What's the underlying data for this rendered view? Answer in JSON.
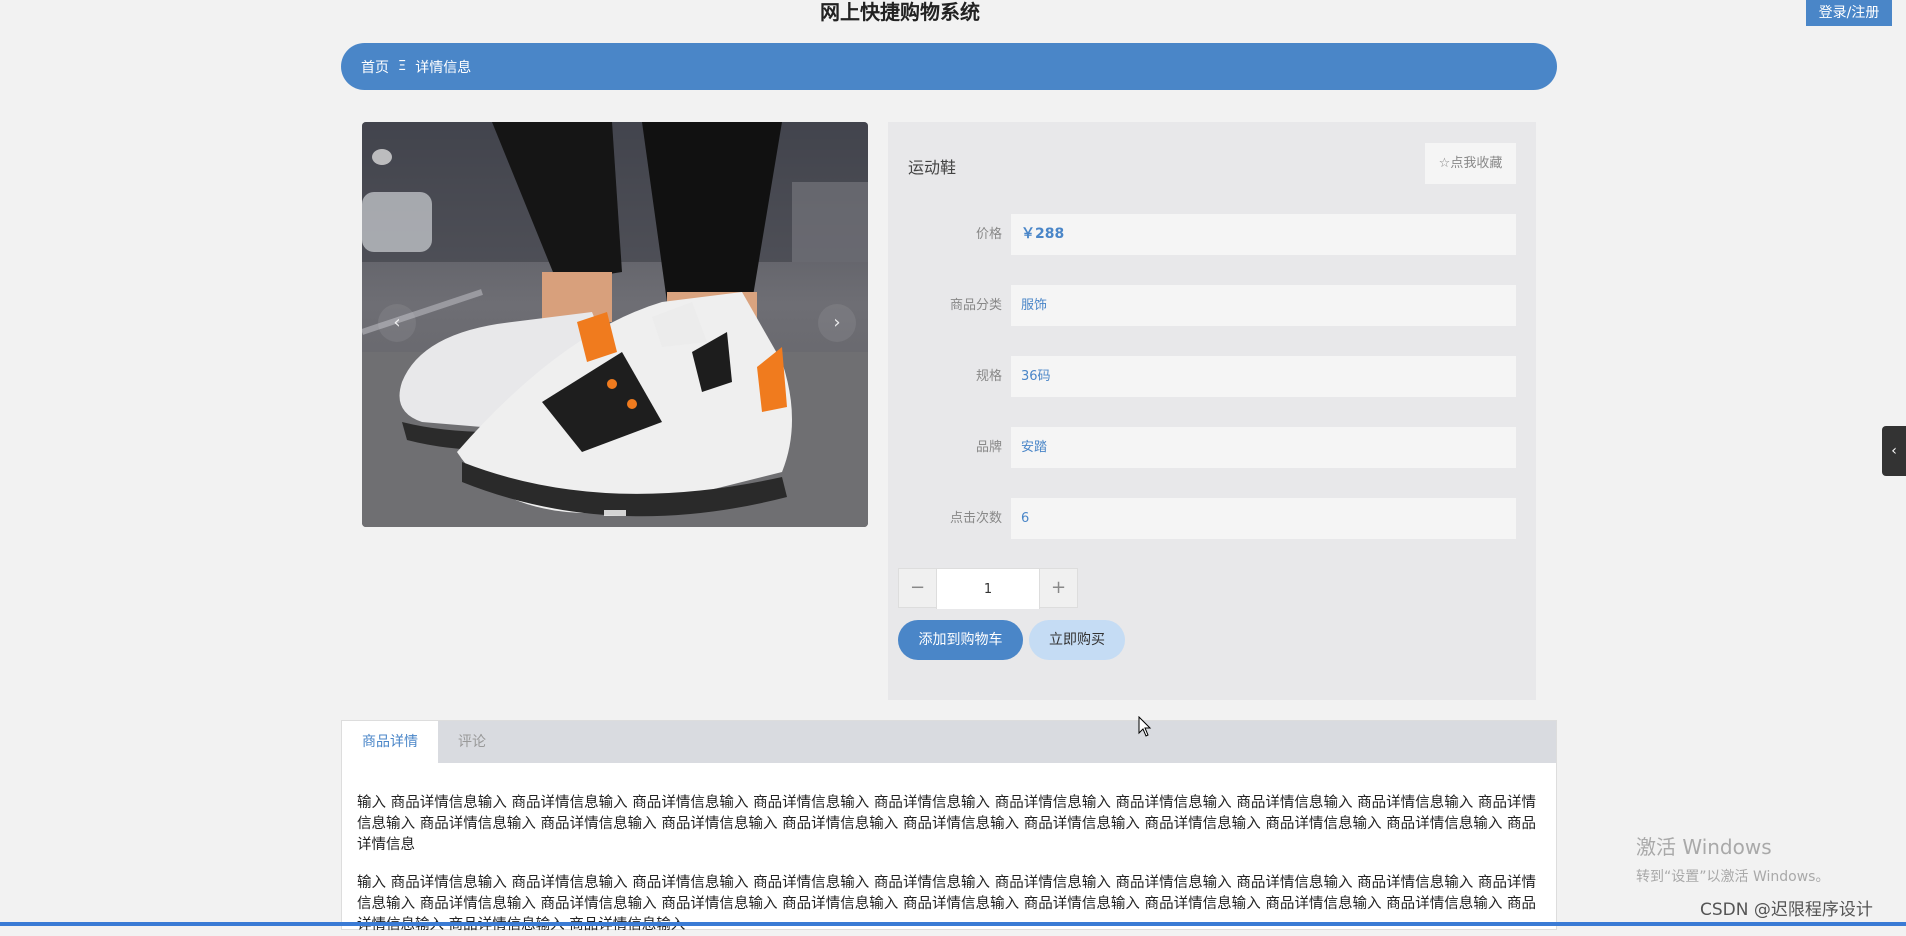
{
  "header": {
    "title": "网上快捷购物系统",
    "login_label": "登录/注册"
  },
  "breadcrumb": {
    "home": "首页",
    "separator": "Ξ",
    "current": "详情信息"
  },
  "carousel": {
    "prev_icon": "‹",
    "next_icon": "›",
    "slide_count_shown": 1
  },
  "product": {
    "name": "运动鞋",
    "favorite_label": "☆点我收藏",
    "fields": [
      {
        "label": "价格",
        "value": "￥288"
      },
      {
        "label": "商品分类",
        "value": "服饰"
      },
      {
        "label": "规格",
        "value": "36码"
      },
      {
        "label": "品牌",
        "value": "安踏"
      },
      {
        "label": "点击次数",
        "value": "6"
      }
    ]
  },
  "quantity": {
    "minus": "−",
    "value": "1",
    "plus": "+"
  },
  "actions": {
    "add_to_cart": "添加到购物车",
    "buy_now": "立即购买"
  },
  "tabs": {
    "items": [
      "商品详情",
      "评论"
    ],
    "active": 0
  },
  "detail": {
    "paragraphs": [
      "输入 商品详情信息输入 商品详情信息输入 商品详情信息输入 商品详情信息输入 商品详情信息输入 商品详情信息输入 商品详情信息输入 商品详情信息输入 商品详情信息输入 商品详情信息输入 商品详情信息输入 商品详情信息输入 商品详情信息输入 商品详情信息输入 商品详情信息输入 商品详情信息输入 商品详情信息输入 商品详情信息输入 商品详情信息输入 商品详情信息",
      "输入 商品详情信息输入 商品详情信息输入 商品详情信息输入 商品详情信息输入 商品详情信息输入 商品详情信息输入 商品详情信息输入 商品详情信息输入 商品详情信息输入 商品详情信息输入 商品详情信息输入 商品详情信息输入 商品详情信息输入 商品详情信息输入 商品详情信息输入 商品详情信息输入 商品详情信息输入 商品详情信息输入 商品详情信息输入 商品详情信息输入 商品详情信息输入 商品详情信息输入"
    ]
  },
  "side_toggle_icon": "‹",
  "overlay": {
    "windows_line1": "激活 Windows",
    "windows_line2": "转到“设置”以激活 Windows。",
    "csdn": "CSDN @迟限程序设计"
  },
  "colors": {
    "accent": "#4a86c8",
    "accent_light": "#c5dcf4",
    "background": "#f2f2f2"
  }
}
